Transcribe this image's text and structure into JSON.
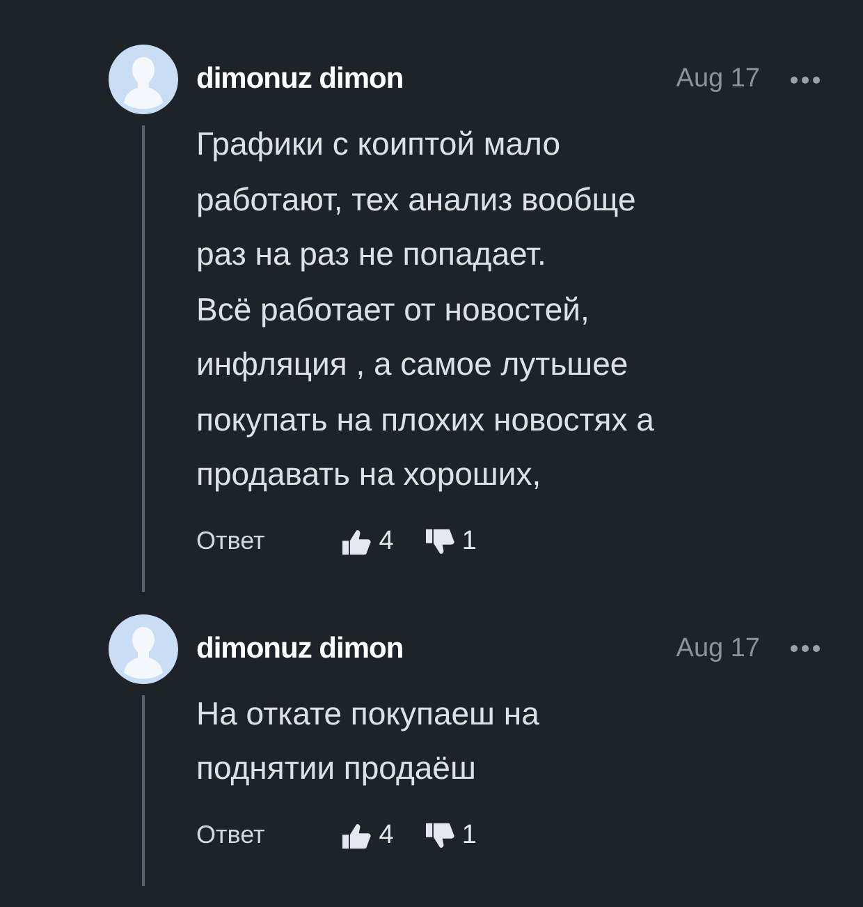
{
  "comments": [
    {
      "author": "dimonuz dimon",
      "date": "Aug 17",
      "text": "Графики с коиптой мало\nработают, тех анализ вообще\nраз на раз не попадает.\nВсё работает от новостей,\nинфляция , а самое лутьшее\nпокупать на плохих новостях а\nпродавать на хороших,",
      "reply": "Ответ",
      "likes": "4",
      "dislikes": "1"
    },
    {
      "author": "dimonuz dimon",
      "date": "Aug 17",
      "text": "На откате покупаеш на\nподнятии продаёш",
      "reply": "Ответ",
      "likes": "4",
      "dislikes": "1"
    }
  ]
}
